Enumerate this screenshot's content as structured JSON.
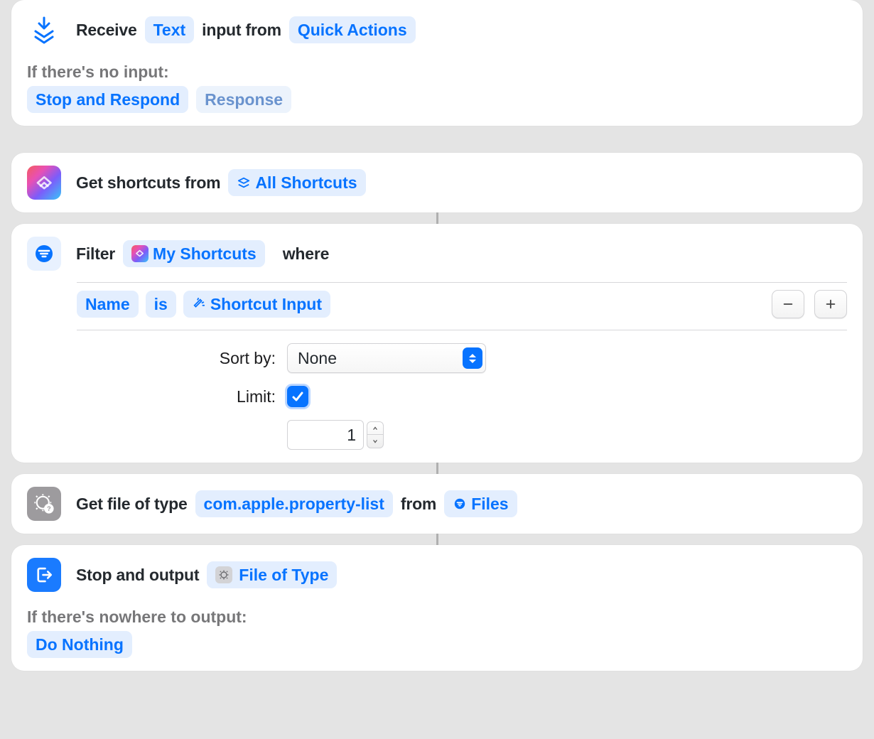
{
  "receive": {
    "prefix": "Receive",
    "type": "Text",
    "middle": "input from",
    "source": "Quick Actions",
    "noinput_label": "If there's no input:",
    "noinput_action": "Stop and Respond",
    "noinput_response": "Response"
  },
  "getshortcuts": {
    "prefix": "Get shortcuts from",
    "source": "All Shortcuts"
  },
  "filter": {
    "prefix": "Filter",
    "source": "My Shortcuts",
    "suffix": "where",
    "field": "Name",
    "operator": "is",
    "value": "Shortcut Input",
    "sort_label": "Sort by:",
    "sort_value": "None",
    "limit_label": "Limit:",
    "limit_value": "1"
  },
  "getfile": {
    "prefix": "Get file of type",
    "type": "com.apple.property-list",
    "middle": "from",
    "source": "Files"
  },
  "output": {
    "prefix": "Stop and output",
    "value": "File of Type",
    "nowhere_label": "If there's nowhere to output:",
    "nowhere_action": "Do Nothing"
  }
}
